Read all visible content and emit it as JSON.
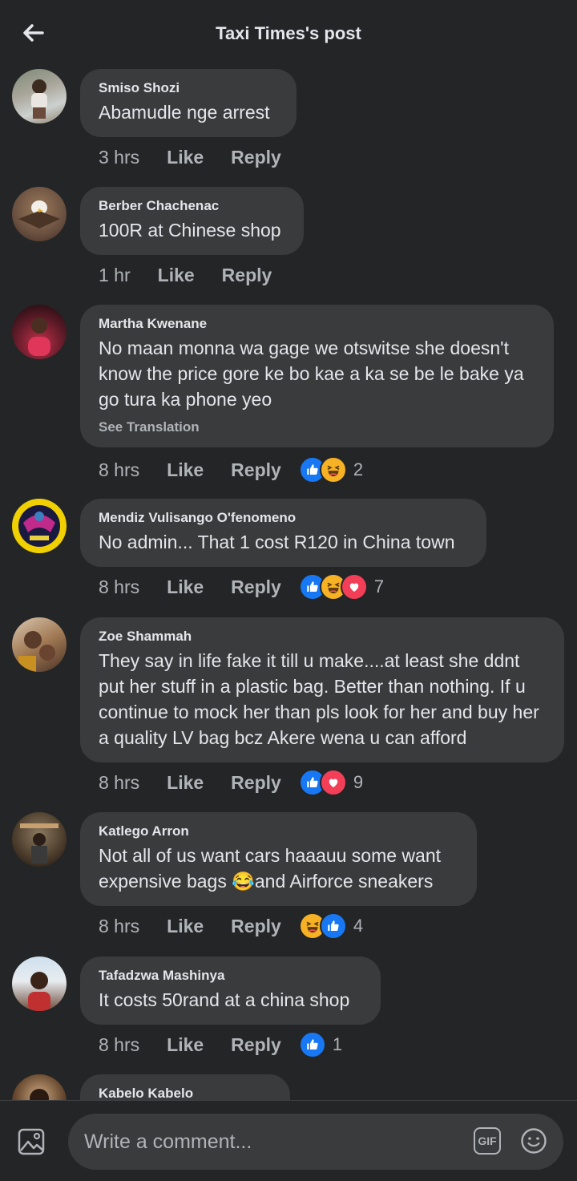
{
  "header": {
    "title": "Taxi Times's post"
  },
  "comments": [
    {
      "author": "Smiso Shozi",
      "text": "Abamudle nge arrest",
      "time": "3 hrs",
      "like": "Like",
      "reply": "Reply",
      "reaction_count": ""
    },
    {
      "author": "Berber Chachenac",
      "text": "100R at Chinese shop",
      "time": "1 hr",
      "like": "Like",
      "reply": "Reply",
      "reaction_count": ""
    },
    {
      "author": "Martha Kwenane",
      "text": "No maan monna wa gage we otswitse she doesn't know the price gore ke bo kae a ka se be le bake ya go tura ka phone yeo",
      "translate": "See Translation",
      "time": "8 hrs",
      "like": "Like",
      "reply": "Reply",
      "reaction_count": "2"
    },
    {
      "author": "Mendiz Vulisango O'fenomeno",
      "text": "No admin... That 1 cost R120 in China town",
      "time": "8 hrs",
      "like": "Like",
      "reply": "Reply",
      "reaction_count": "7"
    },
    {
      "author": "Zoe Shammah",
      "text": "They say in life fake it till u make....at least she ddnt put her stuff in a plastic bag. Better than nothing. If u continue to mock her than pls look for her and buy her a quality LV bag bcz Akere wena u can afford",
      "time": "8 hrs",
      "like": "Like",
      "reply": "Reply",
      "reaction_count": "9"
    },
    {
      "author": "Katlego Arron",
      "text_before": "Not all of us want cars haaauu some want expensive bags ",
      "text_emoji": "😂",
      "text_after": "and Airforce sneakers",
      "time": "8 hrs",
      "like": "Like",
      "reply": "Reply",
      "reaction_count": "4"
    },
    {
      "author": "Tafadzwa Mashinya",
      "text": "It costs 50rand at a china shop",
      "time": "8 hrs",
      "like": "Like",
      "reply": "Reply",
      "reaction_count": "1"
    },
    {
      "author": "Kabelo Kabelo"
    }
  ],
  "composer": {
    "placeholder": "Write a comment...",
    "gif_label": "GIF"
  },
  "colors": {
    "background": "#242526",
    "bubble": "#3a3b3c",
    "like_blue": "#1877f2",
    "haha_yellow": "#f7b125",
    "love_red": "#f33e58"
  },
  "icons": [
    "back-arrow-icon",
    "like-reaction-icon",
    "haha-reaction-icon",
    "love-reaction-icon",
    "photo-icon",
    "gif-icon",
    "emoji-icon"
  ]
}
